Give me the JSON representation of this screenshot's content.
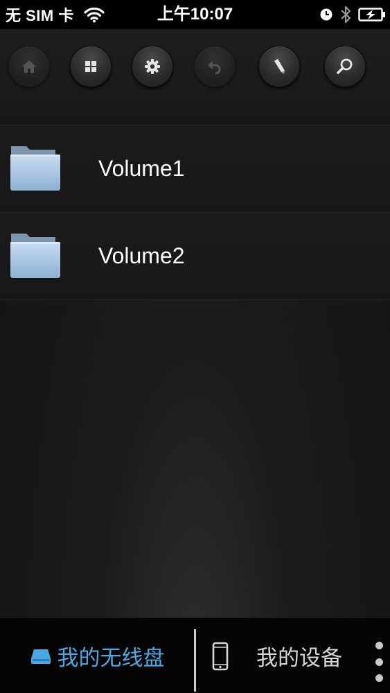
{
  "status_bar": {
    "carrier": "无 SIM 卡",
    "time": "上午10:07",
    "icons": [
      "wifi-icon",
      "alarm-icon",
      "bluetooth-icon",
      "battery-charging-icon"
    ]
  },
  "toolbar": {
    "buttons": [
      {
        "icon": "home-icon",
        "enabled": false
      },
      {
        "icon": "grid-icon",
        "enabled": true
      },
      {
        "icon": "gear-icon",
        "enabled": true
      },
      {
        "icon": "undo-icon",
        "enabled": false
      },
      {
        "icon": "pencil-icon",
        "enabled": true
      },
      {
        "icon": "search-icon",
        "enabled": true
      }
    ]
  },
  "volumes": [
    {
      "label": "Volume1",
      "icon": "folder-icon"
    },
    {
      "label": "Volume2",
      "icon": "folder-icon"
    }
  ],
  "bottom_bar": {
    "tabs": [
      {
        "label": "我的无线盘",
        "icon": "drive-icon",
        "active": true
      },
      {
        "label": "我的设备",
        "icon": "phone-icon",
        "active": false
      }
    ],
    "more_icon": "more-vertical-icon"
  },
  "colors": {
    "accent": "#4aa8e4",
    "background": "#161616",
    "text": "#ffffff"
  }
}
